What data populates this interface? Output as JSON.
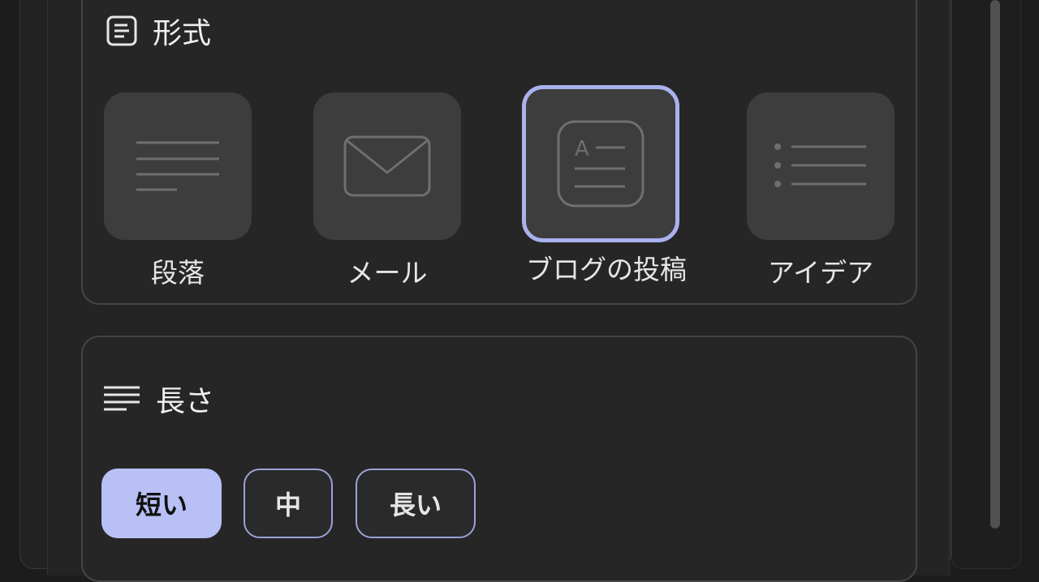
{
  "format": {
    "title": "形式",
    "icon": "document-icon",
    "options": [
      {
        "label": "段落",
        "icon": "paragraph-icon",
        "selected": false
      },
      {
        "label": "メール",
        "icon": "mail-icon",
        "selected": false
      },
      {
        "label": "ブログの投稿",
        "icon": "blog-post-icon",
        "selected": true
      },
      {
        "label": "アイデア",
        "icon": "bullet-list-icon",
        "selected": false
      }
    ]
  },
  "length": {
    "title": "長さ",
    "icon": "text-lines-icon",
    "options": [
      {
        "label": "短い",
        "selected": true
      },
      {
        "label": "中",
        "selected": false
      },
      {
        "label": "長い",
        "selected": false
      }
    ]
  },
  "colors": {
    "accent": "#a9b1ee",
    "selected_chip_bg": "#b8c0f5",
    "tile_bg": "#3d3d3d",
    "background": "#1c1c1c"
  }
}
